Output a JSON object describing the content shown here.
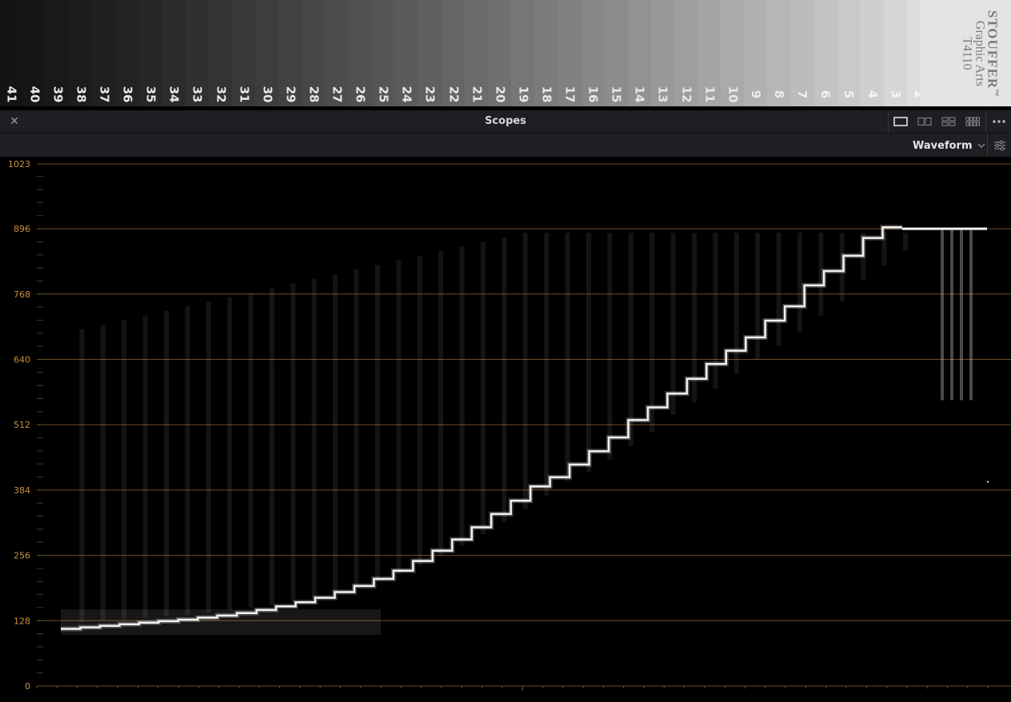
{
  "preview": {
    "step_numbers": [
      "41",
      "40",
      "39",
      "38",
      "37",
      "36",
      "35",
      "34",
      "33",
      "32",
      "31",
      "30",
      "29",
      "28",
      "27",
      "26",
      "25",
      "24",
      "23",
      "22",
      "21",
      "20",
      "19",
      "18",
      "17",
      "16",
      "15",
      "14",
      "13",
      "12",
      "11",
      "10",
      "9",
      "8",
      "7",
      "6",
      "5",
      "4",
      "3",
      "2"
    ],
    "brand": {
      "line1": "STOUFFER",
      "tm": "™",
      "line2": "Graphic Arts",
      "line3": "T4110"
    }
  },
  "titlebar": {
    "close_icon": "close-icon",
    "title": "Scopes",
    "layouts": [
      "single-view-icon",
      "dual-view-icon",
      "quad-view-icon",
      "multi-view-icon"
    ],
    "more_icon": "more-icon"
  },
  "toolbar": {
    "mode": "Waveform",
    "dropdown_icon": "chevron-down-icon",
    "settings_icon": "settings-sliders-icon"
  },
  "scope": {
    "axis_labels": [
      "1023",
      "896",
      "768",
      "640",
      "512",
      "384",
      "256",
      "128",
      "0"
    ],
    "axis_values": [
      1023,
      896,
      768,
      640,
      512,
      384,
      256,
      128,
      0
    ],
    "grid_color": "#6b4e22",
    "label_color": "#c8903c",
    "step_levels": [
      112,
      115,
      118,
      121,
      124,
      127,
      130,
      134,
      138,
      143,
      149,
      156,
      164,
      173,
      184,
      196,
      210,
      226,
      245,
      265,
      287,
      311,
      337,
      363,
      391,
      409,
      434,
      460,
      487,
      521,
      546,
      573,
      602,
      631,
      657,
      683,
      716,
      744,
      785,
      813,
      843,
      878,
      899
    ]
  }
}
